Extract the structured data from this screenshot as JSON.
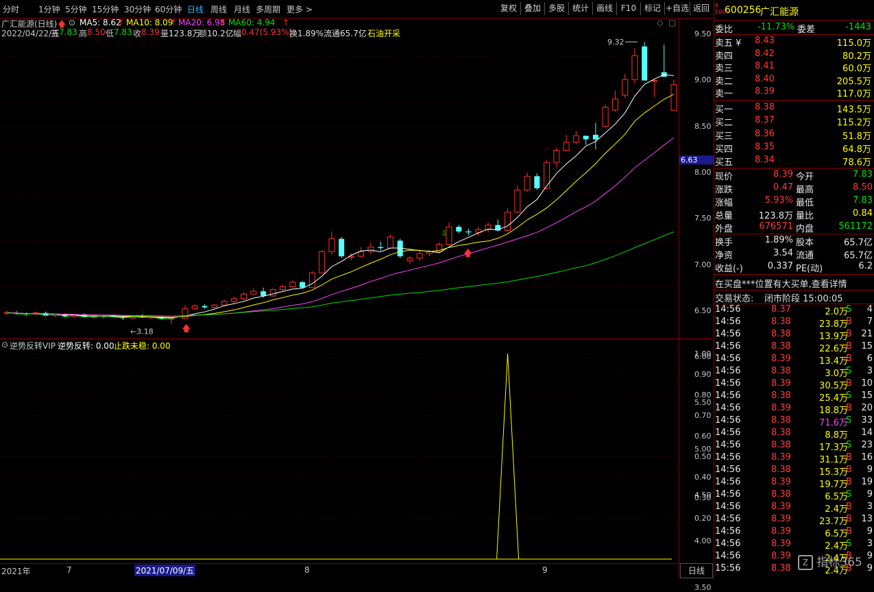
{
  "toolbar": {
    "periods": [
      "分时",
      "1分钟",
      "5分钟",
      "15分钟",
      "30分钟",
      "60分钟",
      "日线",
      "周线",
      "月线",
      "多周期",
      "更多 >"
    ],
    "active_period": "日线",
    "buttons": [
      "复权",
      "叠加",
      "多股",
      "统计",
      "画线",
      "F10",
      "标记",
      "+自选",
      "返回"
    ]
  },
  "info": {
    "stock_title": "广汇能源(日线)",
    "ma5_label": "MA5: 8.62",
    "ma10_label": "MA10: 8.09",
    "ma20_label": "MA20: 6.98",
    "ma60_label": "MA60: 4.94",
    "date": "2022/04/22/五",
    "open_k": "开",
    "open_v": "7.83",
    "high_k": "高",
    "high_v": "8.50",
    "low_k": "低",
    "low_v": "7.83",
    "close_k": "收",
    "close_v": "8.39",
    "vol_k": "量",
    "vol_v": "123.8万",
    "amt_k": "额",
    "amt_v": "10.2亿",
    "chg_k": "幅",
    "chg_v": "0.47(5.93%)",
    "turn": "换1.89%",
    "float": "流通65.7亿",
    "sector": "石油开采"
  },
  "price_axis": [
    "9.50",
    "9.00",
    "8.50",
    "8.00",
    "7.50",
    "7.00",
    "6.50",
    "6.00",
    "5.50",
    "5.00",
    "4.50",
    "4.00",
    "3.50"
  ],
  "price_marker": "6.63",
  "high_label": "9.32",
  "low_label": "3.18",
  "indicator": {
    "name": "逆势反转VIP",
    "v1": "逆势反转: 0.00",
    "v2": "止跌未稳: 0.00",
    "axis": [
      "1.00",
      "0.90",
      "0.80",
      "0.70",
      "0.60",
      "0.50",
      "0.40",
      "0.30",
      "0.20"
    ]
  },
  "time_axis": {
    "year": "2021年",
    "m7": "7",
    "cursor_date": "2021/07/09/五",
    "m8": "8",
    "m9": "9",
    "period_btn": "日线"
  },
  "chart_data": {
    "type": "candlestick",
    "ylim": [
      3.0,
      9.7
    ],
    "candles": [
      [
        3.42,
        3.48,
        3.38,
        3.44
      ],
      [
        3.43,
        3.47,
        3.39,
        3.41
      ],
      [
        3.41,
        3.44,
        3.36,
        3.4
      ],
      [
        3.4,
        3.45,
        3.37,
        3.43
      ],
      [
        3.43,
        3.46,
        3.36,
        3.37
      ],
      [
        3.37,
        3.41,
        3.34,
        3.4
      ],
      [
        3.4,
        3.42,
        3.33,
        3.35
      ],
      [
        3.35,
        3.4,
        3.32,
        3.38
      ],
      [
        3.38,
        3.42,
        3.33,
        3.34
      ],
      [
        3.34,
        3.37,
        3.3,
        3.35
      ],
      [
        3.35,
        3.38,
        3.3,
        3.36
      ],
      [
        3.36,
        3.4,
        3.33,
        3.34
      ],
      [
        3.34,
        3.36,
        3.28,
        3.32
      ],
      [
        3.32,
        3.37,
        3.3,
        3.35
      ],
      [
        3.35,
        3.4,
        3.32,
        3.33
      ],
      [
        3.33,
        3.36,
        3.3,
        3.34
      ],
      [
        3.34,
        3.37,
        3.28,
        3.3
      ],
      [
        3.3,
        3.34,
        3.18,
        3.31
      ],
      [
        3.31,
        3.6,
        3.3,
        3.52
      ],
      [
        3.52,
        3.62,
        3.5,
        3.58
      ],
      [
        3.58,
        3.62,
        3.52,
        3.55
      ],
      [
        3.55,
        3.63,
        3.53,
        3.6
      ],
      [
        3.6,
        3.72,
        3.58,
        3.68
      ],
      [
        3.68,
        3.78,
        3.64,
        3.74
      ],
      [
        3.74,
        3.88,
        3.7,
        3.84
      ],
      [
        3.84,
        3.96,
        3.82,
        3.9
      ],
      [
        3.9,
        3.98,
        3.76,
        3.8
      ],
      [
        3.8,
        3.96,
        3.78,
        3.94
      ],
      [
        3.94,
        4.04,
        3.9,
        4.0
      ],
      [
        4.0,
        4.14,
        3.98,
        4.1
      ],
      [
        4.1,
        4.12,
        3.96,
        3.98
      ],
      [
        3.98,
        4.34,
        3.97,
        4.3
      ],
      [
        4.3,
        4.8,
        4.28,
        4.76
      ],
      [
        4.76,
        5.2,
        4.7,
        5.04
      ],
      [
        5.04,
        5.08,
        4.62,
        4.66
      ],
      [
        4.64,
        4.72,
        4.58,
        4.66
      ],
      [
        4.66,
        4.86,
        4.64,
        4.76
      ],
      [
        4.76,
        4.96,
        4.7,
        4.86
      ],
      [
        4.86,
        4.98,
        4.78,
        4.84
      ],
      [
        4.84,
        5.14,
        4.82,
        5.08
      ],
      [
        5.0,
        5.04,
        4.62,
        4.66
      ],
      [
        4.56,
        4.66,
        4.5,
        4.62
      ],
      [
        4.62,
        4.8,
        4.56,
        4.72
      ],
      [
        4.72,
        4.8,
        4.66,
        4.76
      ],
      [
        4.76,
        4.96,
        4.74,
        4.92
      ],
      [
        4.92,
        5.4,
        4.9,
        5.3
      ],
      [
        5.3,
        5.34,
        5.16,
        5.2
      ],
      [
        5.2,
        5.26,
        5.12,
        5.18
      ],
      [
        5.18,
        5.3,
        5.1,
        5.24
      ],
      [
        5.24,
        5.4,
        5.18,
        5.34
      ],
      [
        5.34,
        5.46,
        5.2,
        5.22
      ],
      [
        5.22,
        5.7,
        5.2,
        5.62
      ],
      [
        5.62,
        6.2,
        5.6,
        6.1
      ],
      [
        6.1,
        6.48,
        6.06,
        6.4
      ],
      [
        6.4,
        6.46,
        6.1,
        6.14
      ],
      [
        6.14,
        6.76,
        6.12,
        6.7
      ],
      [
        6.7,
        7.02,
        6.6,
        6.96
      ],
      [
        6.96,
        7.3,
        6.94,
        7.14
      ],
      [
        7.14,
        7.38,
        7.1,
        7.28
      ],
      [
        7.28,
        7.26,
        7.08,
        7.2
      ],
      [
        7.3,
        7.56,
        6.98,
        7.2
      ],
      [
        7.48,
        7.96,
        7.44,
        7.9
      ],
      [
        7.84,
        8.26,
        7.8,
        8.08
      ],
      [
        8.16,
        8.62,
        8.1,
        8.5
      ],
      [
        8.5,
        9.18,
        8.42,
        9.02
      ],
      [
        9.22,
        9.32,
        8.48,
        8.48
      ],
      [
        8.48,
        8.52,
        8.12,
        8.48
      ],
      [
        8.66,
        9.26,
        8.6,
        8.56
      ],
      [
        7.83,
        8.5,
        7.83,
        8.39
      ]
    ],
    "up_color": "#ff3030",
    "down_color": "#54ffff",
    "ma_colors": {
      "ma5": "#ffffff",
      "ma10": "#ffff00",
      "ma20": "#ff40ff",
      "ma60": "#00e000"
    },
    "indicator_series": {
      "spike_index": 51,
      "spike_value": 1.0
    }
  },
  "order_book": {
    "code": "600256",
    "name": "广汇能源",
    "weibi_k": "委比",
    "weibi_v": "-11.73%",
    "weicha_k": "委差",
    "weicha_v": "-1443",
    "asks": [
      {
        "label": "卖五 ¥",
        "price": "8.43",
        "vol": "115.0万"
      },
      {
        "label": "卖四",
        "price": "8.42",
        "vol": "80.2万"
      },
      {
        "label": "卖三",
        "price": "8.41",
        "vol": "60.0万"
      },
      {
        "label": "卖二",
        "price": "8.40",
        "vol": "205.5万"
      },
      {
        "label": "卖一",
        "price": "8.39",
        "vol": "117.0万"
      }
    ],
    "bids": [
      {
        "label": "买一",
        "price": "8.38",
        "vol": "143.5万"
      },
      {
        "label": "买二",
        "price": "8.37",
        "vol": "115.2万"
      },
      {
        "label": "买三",
        "price": "8.36",
        "vol": "51.8万"
      },
      {
        "label": "买四",
        "price": "8.35",
        "vol": "64.8万"
      },
      {
        "label": "买五",
        "price": "8.34",
        "vol": "78.6万"
      }
    ],
    "stats": [
      {
        "k1": "现价",
        "v1": "8.39",
        "c1": "red",
        "k2": "今开",
        "v2": "7.83",
        "c2": "green"
      },
      {
        "k1": "涨跌",
        "v1": "0.47",
        "c1": "red",
        "k2": "最高",
        "v2": "8.50",
        "c2": "red"
      },
      {
        "k1": "涨幅",
        "v1": "5.93%",
        "c1": "red",
        "k2": "最低",
        "v2": "7.83",
        "c2": "green"
      },
      {
        "k1": "总量",
        "v1": "123.8万",
        "c1": "white",
        "k2": "量比",
        "v2": "0.84",
        "c2": "yellow"
      },
      {
        "k1": "外盘",
        "v1": "676571",
        "c1": "red",
        "k2": "内盘",
        "v2": "561172",
        "c2": "green"
      }
    ],
    "stats2": [
      {
        "k1": "换手",
        "v1": "1.89%",
        "k2": "股本",
        "v2": "65.7亿"
      },
      {
        "k1": "净资",
        "v1": "3.54",
        "k2": "流通",
        "v2": "65.7亿"
      },
      {
        "k1": "收益(-)",
        "v1": "0.337",
        "k2": "PE(动)",
        "v2": "6.2"
      }
    ],
    "notice": "在买盘***位置有大买单,查看详情",
    "status_k": "交易状态:",
    "status_v": "闭市阶段 15:00:05"
  },
  "ticks": [
    {
      "t": "14:56",
      "p": "8.37",
      "pc": "red",
      "v": "2.0万",
      "vc": "yellow",
      "s": "S",
      "sc": "green",
      "n": "4"
    },
    {
      "t": "14:56",
      "p": "8.38",
      "pc": "red",
      "v": "23.8万",
      "vc": "yellow",
      "s": "B",
      "sc": "red",
      "n": "7"
    },
    {
      "t": "14:56",
      "p": "8.38",
      "pc": "red",
      "v": "13.9万",
      "vc": "yellow",
      "s": "B",
      "sc": "red",
      "n": "21"
    },
    {
      "t": "14:56",
      "p": "8.38",
      "pc": "red",
      "v": "22.6万",
      "vc": "yellow",
      "s": "B",
      "sc": "red",
      "n": "15"
    },
    {
      "t": "14:56",
      "p": "8.39",
      "pc": "red",
      "v": "13.4万",
      "vc": "yellow",
      "s": "B",
      "sc": "red",
      "n": "6"
    },
    {
      "t": "14:56",
      "p": "8.38",
      "pc": "red",
      "v": "3.0万",
      "vc": "yellow",
      "s": "S",
      "sc": "green",
      "n": "3"
    },
    {
      "t": "14:56",
      "p": "8.39",
      "pc": "red",
      "v": "30.5万",
      "vc": "yellow",
      "s": "B",
      "sc": "red",
      "n": "10"
    },
    {
      "t": "14:56",
      "p": "8.38",
      "pc": "red",
      "v": "25.4万",
      "vc": "yellow",
      "s": "S",
      "sc": "green",
      "n": "15"
    },
    {
      "t": "14:56",
      "p": "8.39",
      "pc": "red",
      "v": "18.8万",
      "vc": "yellow",
      "s": "B",
      "sc": "red",
      "n": "20"
    },
    {
      "t": "14:56",
      "p": "8.38",
      "pc": "red",
      "v": "71.6万",
      "vc": "magenta",
      "s": "S",
      "sc": "green",
      "n": "33"
    },
    {
      "t": "14:56",
      "p": "8.38",
      "pc": "red",
      "v": "8.8万",
      "vc": "yellow",
      "s": "",
      "sc": "green",
      "n": "14"
    },
    {
      "t": "14:56",
      "p": "8.38",
      "pc": "red",
      "v": "17.3万",
      "vc": "yellow",
      "s": "S",
      "sc": "green",
      "n": "23"
    },
    {
      "t": "14:56",
      "p": "8.39",
      "pc": "red",
      "v": "31.1万",
      "vc": "yellow",
      "s": "B",
      "sc": "red",
      "n": "16"
    },
    {
      "t": "14:56",
      "p": "8.38",
      "pc": "red",
      "v": "15.3万",
      "vc": "yellow",
      "s": "B",
      "sc": "red",
      "n": "9"
    },
    {
      "t": "14:56",
      "p": "8.39",
      "pc": "red",
      "v": "19.7万",
      "vc": "yellow",
      "s": "B",
      "sc": "red",
      "n": "19"
    },
    {
      "t": "14:56",
      "p": "8.38",
      "pc": "red",
      "v": "6.5万",
      "vc": "yellow",
      "s": "S",
      "sc": "green",
      "n": "9"
    },
    {
      "t": "14:56",
      "p": "8.39",
      "pc": "red",
      "v": "2.4万",
      "vc": "yellow",
      "s": "B",
      "sc": "red",
      "n": "3"
    },
    {
      "t": "14:56",
      "p": "8.39",
      "pc": "red",
      "v": "23.7万",
      "vc": "yellow",
      "s": "B",
      "sc": "red",
      "n": "13"
    },
    {
      "t": "14:56",
      "p": "8.39",
      "pc": "red",
      "v": "6.5万",
      "vc": "yellow",
      "s": "B",
      "sc": "red",
      "n": "9"
    },
    {
      "t": "14:56",
      "p": "8.39",
      "pc": "red",
      "v": "2.4万",
      "vc": "yellow",
      "s": "S",
      "sc": "green",
      "n": "3"
    },
    {
      "t": "14:56",
      "p": "8.39",
      "pc": "red",
      "v": "2.4万",
      "vc": "yellow",
      "s": "B",
      "sc": "red",
      "n": "9"
    },
    {
      "t": "15:56",
      "p": "8.38",
      "pc": "red",
      "v": "2.4万",
      "vc": "yellow",
      "s": "B",
      "sc": "red",
      "n": "9"
    }
  ],
  "watermark": "指标365"
}
